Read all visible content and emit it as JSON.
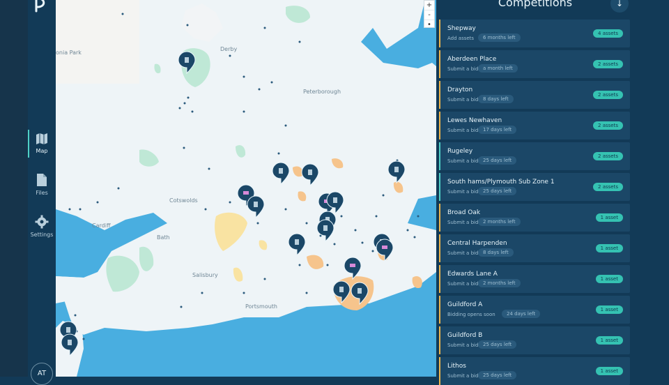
{
  "nav": {
    "items": [
      {
        "label": "Map",
        "icon": "map-icon",
        "active": true
      },
      {
        "label": "Files",
        "icon": "file-icon",
        "active": false
      },
      {
        "label": "Settings",
        "icon": "gear-icon",
        "active": false
      }
    ],
    "avatar": "AT"
  },
  "map": {
    "labels": {
      "derby": "Derby",
      "peterborough": "Peterborough",
      "cotswolds": "Cotswolds",
      "cardiff": "Cardiff",
      "bath": "Bath",
      "salisbury": "Salisbury",
      "portsmouth": "Portsmouth",
      "park_partial": "onia\nPark"
    },
    "zoom": {
      "plus": "+",
      "minus": "-",
      "reset": "•"
    }
  },
  "panel": {
    "title": "Competitions",
    "download_icon": "download-icon",
    "competitions": [
      {
        "name": "Shepway",
        "status": "Add assets",
        "time": "6 months left",
        "assets": "4 assets",
        "color": "#f0b64b"
      },
      {
        "name": "Aberdeen Place",
        "status": "Submit a bid",
        "time": "a month left",
        "assets": "2 assets",
        "color": "#f0b64b"
      },
      {
        "name": "Drayton",
        "status": "Submit a bid",
        "time": "8 days left",
        "assets": "2 assets",
        "color": "#f0b64b"
      },
      {
        "name": "Lewes Newhaven",
        "status": "Submit a bid",
        "time": "17 days left",
        "assets": "2 assets",
        "color": "#f0b64b"
      },
      {
        "name": "Rugeley",
        "status": "Submit a bid",
        "time": "25 days left",
        "assets": "2 assets",
        "color": "#4fd0c6"
      },
      {
        "name": "South hams/Plymouth Sub Zone 1",
        "status": "Submit a bid",
        "time": "25 days left",
        "assets": "2 assets",
        "color": "#4fd0c6"
      },
      {
        "name": "Broad Oak",
        "status": "Submit a bid",
        "time": "2 months left",
        "assets": "1 asset",
        "color": "#f0b64b"
      },
      {
        "name": "Central Harpenden",
        "status": "Submit a bid",
        "time": "8 days left",
        "assets": "1 asset",
        "color": "#f0b64b"
      },
      {
        "name": "Edwards Lane A",
        "status": "Submit a bid",
        "time": "2 months left",
        "assets": "1 asset",
        "color": "#f0b64b"
      },
      {
        "name": "Guildford A",
        "status": "Bidding opens soon",
        "time": "24 days left",
        "assets": "1 asset",
        "color": "#f0b64b"
      },
      {
        "name": "Guildford B",
        "status": "Submit a bid",
        "time": "25 days left",
        "assets": "1 asset",
        "color": "#f0b64b"
      },
      {
        "name": "Lithos",
        "status": "Submit a bid",
        "time": "25 days left",
        "assets": "1 asset",
        "color": "#f0b64b"
      }
    ]
  }
}
